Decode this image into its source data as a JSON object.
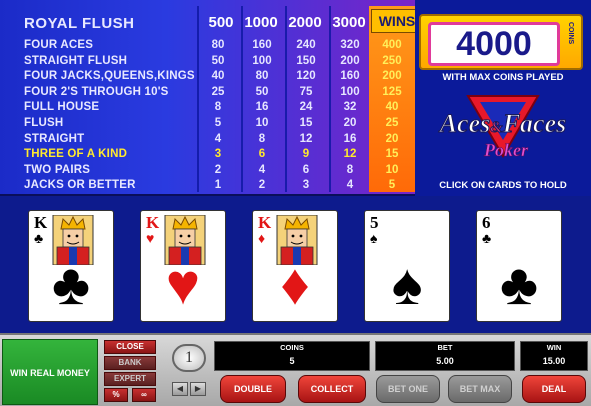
{
  "paytable": {
    "title": "ROYAL FLUSH",
    "coin_columns": [
      "500",
      "1000",
      "2000",
      "3000"
    ],
    "wins_label": "WINS",
    "rows": [
      {
        "name": "FOUR ACES",
        "values": [
          "80",
          "160",
          "240",
          "320"
        ],
        "win": "400",
        "highlight": false
      },
      {
        "name": "STRAIGHT FLUSH",
        "values": [
          "50",
          "100",
          "150",
          "200"
        ],
        "win": "250",
        "highlight": false
      },
      {
        "name": "FOUR JACKS,QUEENS,KINGS",
        "values": [
          "40",
          "80",
          "120",
          "160"
        ],
        "win": "200",
        "highlight": false
      },
      {
        "name": "FOUR 2'S THROUGH 10'S",
        "values": [
          "25",
          "50",
          "75",
          "100"
        ],
        "win": "125",
        "highlight": false
      },
      {
        "name": "FULL HOUSE",
        "values": [
          "8",
          "16",
          "24",
          "32"
        ],
        "win": "40",
        "highlight": false
      },
      {
        "name": "FLUSH",
        "values": [
          "5",
          "10",
          "15",
          "20"
        ],
        "win": "25",
        "highlight": false
      },
      {
        "name": "STRAIGHT",
        "values": [
          "4",
          "8",
          "12",
          "16"
        ],
        "win": "20",
        "highlight": false
      },
      {
        "name": "THREE OF A KIND",
        "values": [
          "3",
          "6",
          "9",
          "12"
        ],
        "win": "15",
        "highlight": true
      },
      {
        "name": "TWO PAIRS",
        "values": [
          "2",
          "4",
          "6",
          "8"
        ],
        "win": "10",
        "highlight": false
      },
      {
        "name": "JACKS OR BETTER",
        "values": [
          "1",
          "2",
          "3",
          "4"
        ],
        "win": "5",
        "highlight": false
      }
    ]
  },
  "info_panel": {
    "coins_display": "4000",
    "coins_side_label": "COINS",
    "max_coins_text": "WITH MAX COINS PLAYED",
    "logo_line1": "Aces",
    "logo_amp": "&",
    "logo_line2": "Faces",
    "logo_line3": "Poker",
    "hold_message": "CLICK ON CARDS TO HOLD"
  },
  "cards": [
    {
      "rank": "K",
      "suit": "♣",
      "color": "black",
      "face": true
    },
    {
      "rank": "K",
      "suit": "♥",
      "color": "red",
      "face": true
    },
    {
      "rank": "K",
      "suit": "♦",
      "color": "red",
      "face": true
    },
    {
      "rank": "5",
      "suit": "♠",
      "color": "black",
      "face": false
    },
    {
      "rank": "6",
      "suit": "♣",
      "color": "black",
      "face": false
    }
  ],
  "controls": {
    "real_money": "WIN REAL MONEY",
    "close": "CLOSE",
    "bank": "BANK",
    "expert": "EXPERT",
    "percent": "%",
    "infinity": "∞",
    "coin_value": "1",
    "coins_label": "COINS",
    "coins_value": "5",
    "bet_label": "BET",
    "bet_value": "5.00",
    "win_label": "WIN",
    "win_value": "15.00",
    "double": "DOUBLE",
    "collect": "COLLECT",
    "bet_one": "BET ONE",
    "bet_max": "BET MAX",
    "deal": "DEAL"
  },
  "colors": {
    "accent_yellow": "#ffea2e",
    "wins_orange": "#ff7a10",
    "table_blue": "#0d1b8d",
    "button_red": "#c82020"
  }
}
